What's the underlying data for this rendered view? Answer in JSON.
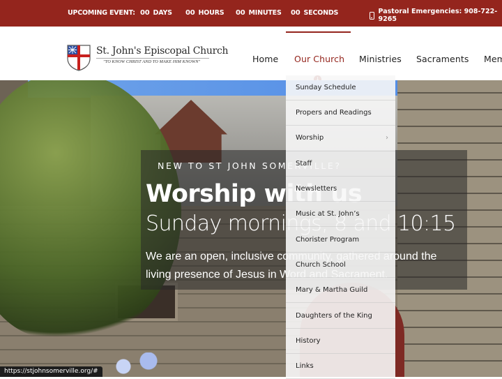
{
  "topbar": {
    "event_label": "UPCOMING EVENT:",
    "countdown": [
      {
        "value": "00",
        "unit": "DAYS"
      },
      {
        "value": "00",
        "unit": "HOURS"
      },
      {
        "value": "00",
        "unit": "MINUTES"
      },
      {
        "value": "00",
        "unit": "SECONDS"
      }
    ],
    "phone_icon": "mobile-phone-icon",
    "emergency_text": "Pastoral Emergencies: 908-722-9265"
  },
  "header": {
    "logo_icon": "episcopal-shield-icon",
    "title": "St. John's Episcopal Church",
    "motto": "\"TO KNOW CHRIST AND TO MAKE HIM KNOWN\""
  },
  "nav": {
    "items": [
      {
        "label": "Home"
      },
      {
        "label": "Our Church",
        "active": true
      },
      {
        "label": "Ministries"
      },
      {
        "label": "Sacraments"
      },
      {
        "label": "Mem"
      }
    ],
    "dropdown_indicator": "arrow-down-circle-icon",
    "accent_color": "#94251d"
  },
  "dropdown": {
    "items": [
      {
        "label": "Sunday Schedule"
      },
      {
        "label": "Propers and Readings"
      },
      {
        "label": "Worship",
        "has_submenu": true,
        "submenu_icon": "chevron-right-icon"
      },
      {
        "label": "Staff"
      },
      {
        "label": "Newsletters"
      },
      {
        "label": "Music at St. John’s"
      },
      {
        "label": "Chorister Program"
      },
      {
        "label": "Church School"
      },
      {
        "label": "Mary & Martha Guild"
      },
      {
        "label": "Daughters of the King"
      },
      {
        "label": "History"
      },
      {
        "label": "Links"
      }
    ]
  },
  "hero": {
    "kicker": "NEW TO ST JOHN SOMERVILLE?",
    "title": "Worship with us",
    "subtitle": "Sunday mornings, 8 and 10:15",
    "description": "We are an open, inclusive community, gathered around the living presence of Jesus in Word and Sacrament."
  },
  "statusbar": {
    "url": "https://stjohnsomerville.org/#"
  }
}
